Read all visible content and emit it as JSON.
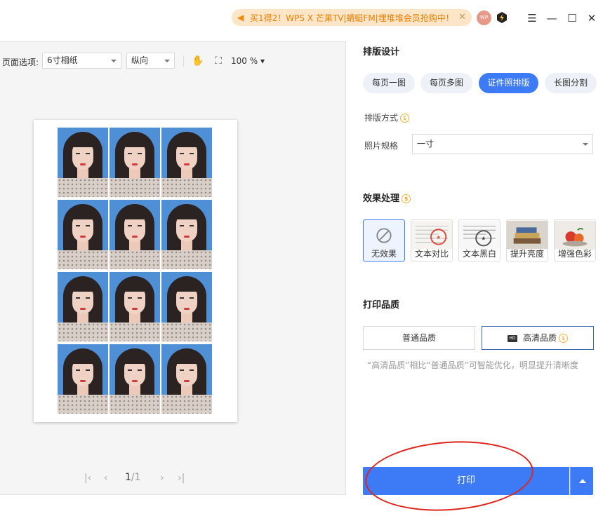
{
  "titlebar": {
    "promo_text": "买1得2！WPS X 芒果TV|蜻蜓FM|埋堆堆会员抢购中！",
    "avatar_text": "WP"
  },
  "preview": {
    "page_options_label": "页面选项:",
    "paper_size": "6寸相纸",
    "orientation": "纵向",
    "zoom": "100 %",
    "page_current": "1",
    "page_total": "/1",
    "photo_grid": {
      "rows": 4,
      "cols": 3
    }
  },
  "layout_design": {
    "title": "排版设计",
    "tabs": [
      "每页一图",
      "每页多图",
      "证件照排版",
      "长图分割"
    ],
    "active_tab_index": 2,
    "mode_label": "排版方式",
    "photo_spec_label": "照片规格",
    "photo_spec_value": "一寸"
  },
  "effects": {
    "title": "效果处理",
    "items": [
      "无效果",
      "文本对比",
      "文本黑白",
      "提升亮度",
      "增强色彩"
    ],
    "active_index": 0
  },
  "print_quality": {
    "title": "打印品质",
    "normal": "普通品质",
    "hd": "高清品质",
    "hd_badge": "HD",
    "note": "“高清品质”相比“普通品质”可智能优化，明显提升清晰度"
  },
  "print_button": "打印",
  "colors": {
    "accent": "#3c7bf5",
    "promo_bg": "#fde6c8",
    "promo_text": "#e67e00",
    "annotation": "#e0231a"
  }
}
